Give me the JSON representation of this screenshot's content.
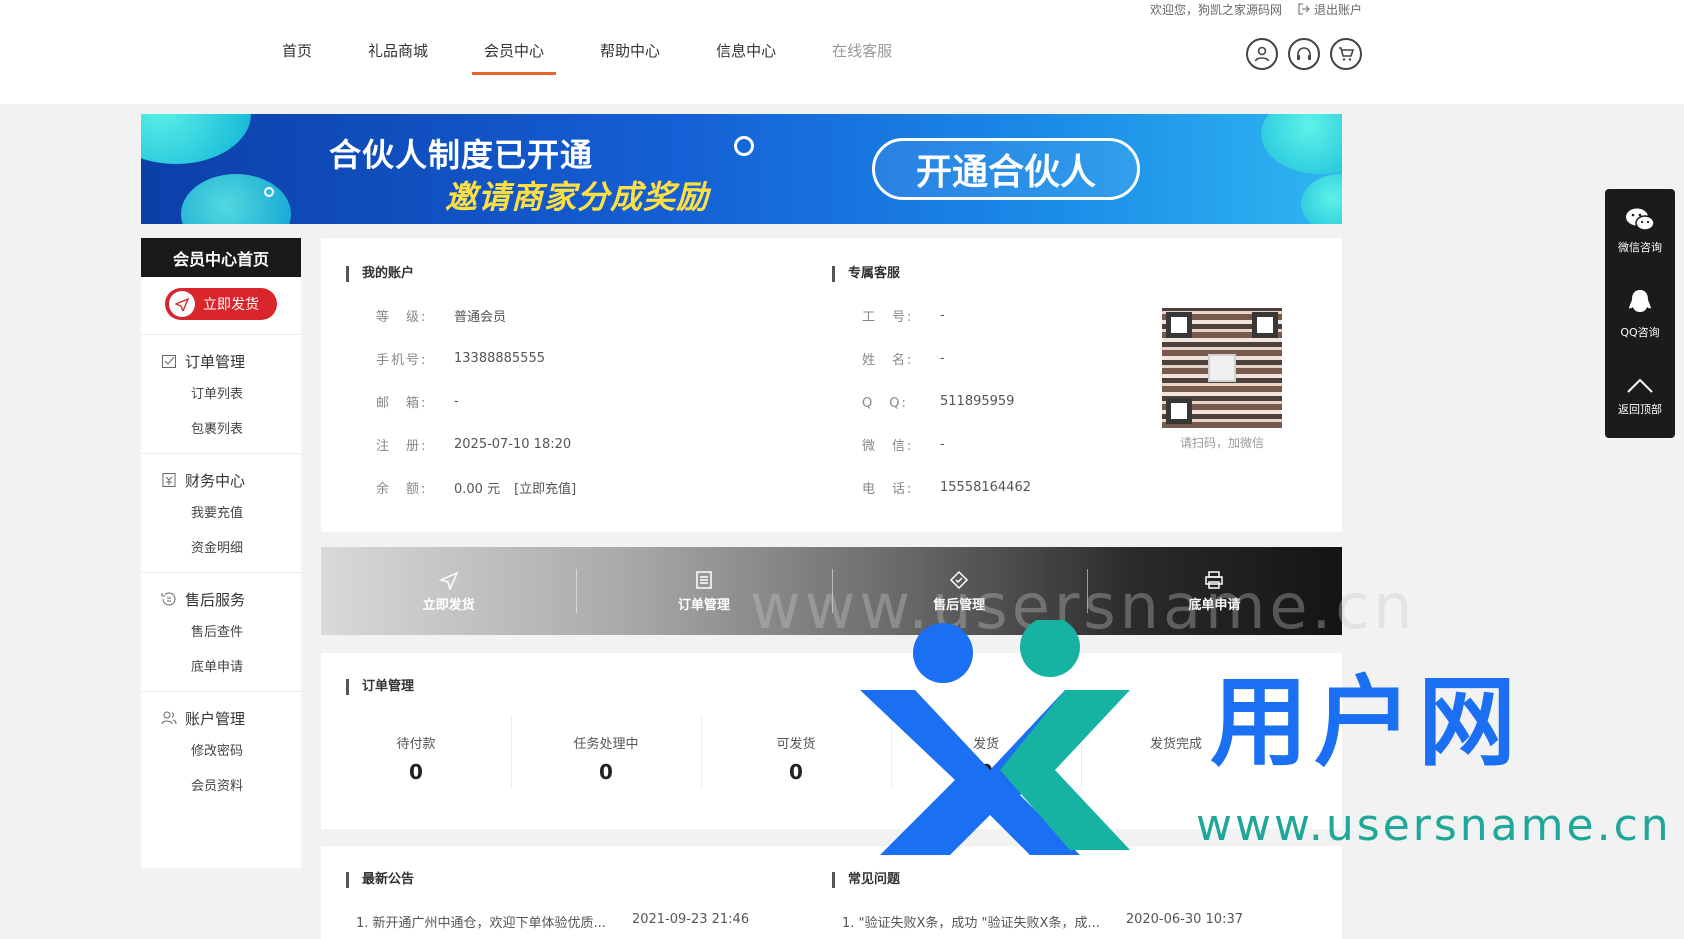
{
  "topbar": {
    "welcome": "欢迎您，狗凯之家源码网",
    "logout": "退出账户"
  },
  "nav": [
    {
      "label": "首页"
    },
    {
      "label": "礼品商城"
    },
    {
      "label": "会员中心"
    },
    {
      "label": "帮助中心"
    },
    {
      "label": "信息中心"
    },
    {
      "label": "在线客服"
    }
  ],
  "header_icons": [
    "user-icon",
    "headset-icon",
    "cart-icon"
  ],
  "banner": {
    "line1": "合伙人制度已开通",
    "line2": "邀请商家分成奖励",
    "button": "开通合伙人"
  },
  "sidebar": {
    "title": "会员中心首页",
    "ship_button": "立即发货",
    "groups": [
      {
        "icon": "checkbox-icon",
        "label": "订单管理",
        "links": [
          "订单列表",
          "包裹列表"
        ]
      },
      {
        "icon": "finance-icon",
        "label": "财务中心",
        "links": [
          "我要充值",
          "资金明细"
        ]
      },
      {
        "icon": "service-icon",
        "label": "售后服务",
        "links": [
          "售后查件",
          "底单申请"
        ]
      },
      {
        "icon": "users-icon",
        "label": "账户管理",
        "links": [
          "修改密码",
          "会员资料"
        ]
      }
    ]
  },
  "account": {
    "title": "我的账户",
    "rows": [
      {
        "k": "等　级:",
        "v": "普通会员"
      },
      {
        "k": "手机号:",
        "v": "13388885555"
      },
      {
        "k": "邮　箱:",
        "v": "-"
      },
      {
        "k": "注　册:",
        "v": "2025-07-10 18:20"
      },
      {
        "k": "余　额:",
        "v": "0.00 元"
      }
    ],
    "recharge": "[立即充值]"
  },
  "service": {
    "title": "专属客服",
    "rows": [
      {
        "k": "工　号:",
        "v": "-"
      },
      {
        "k": "姓　名:",
        "v": "-"
      },
      {
        "k": "Q　Q:",
        "v": "511895959"
      },
      {
        "k": "微　信:",
        "v": "-"
      },
      {
        "k": "电　话:",
        "v": "15558164462"
      }
    ],
    "qr_caption": "请扫码，加微信"
  },
  "actions": [
    {
      "icon": "send-icon",
      "label": "立即发货"
    },
    {
      "icon": "list-icon",
      "label": "订单管理"
    },
    {
      "icon": "tag-icon",
      "label": "售后管理"
    },
    {
      "icon": "printer-icon",
      "label": "底单申请"
    }
  ],
  "orders": {
    "title": "订单管理",
    "stats": [
      {
        "label": "待付款",
        "value": "0"
      },
      {
        "label": "任务处理中",
        "value": "0"
      },
      {
        "label": "可发货",
        "value": "0"
      },
      {
        "label": "发货",
        "value": "0"
      },
      {
        "label": "发货完成",
        "value": ""
      }
    ]
  },
  "notices": {
    "title": "最新公告",
    "items": [
      {
        "text": "1. 新开通广州中通仓，欢迎下单体验优质...",
        "date": "2021-09-23 21:46"
      }
    ]
  },
  "faq": {
    "title": "常见问题",
    "items": [
      {
        "text": "1. \"验证失败X条，成功 \"验证失败X条，成...",
        "date": "2020-06-30 10:37"
      }
    ]
  },
  "float_panel": [
    {
      "icon": "wechat-icon",
      "label": "微信咨询"
    },
    {
      "icon": "qq-icon",
      "label": "QQ咨询"
    },
    {
      "icon": "arrow-up-icon",
      "label": "返回顶部"
    }
  ],
  "watermark": {
    "brand": "用户网",
    "url": "www.usersname.cn",
    "faint": "www.usersname.cn"
  },
  "colors": {
    "accent": "#e8652b",
    "ship": "#d9252b",
    "brand_blue": "#1a6ff2",
    "brand_teal": "#1fa89a"
  }
}
